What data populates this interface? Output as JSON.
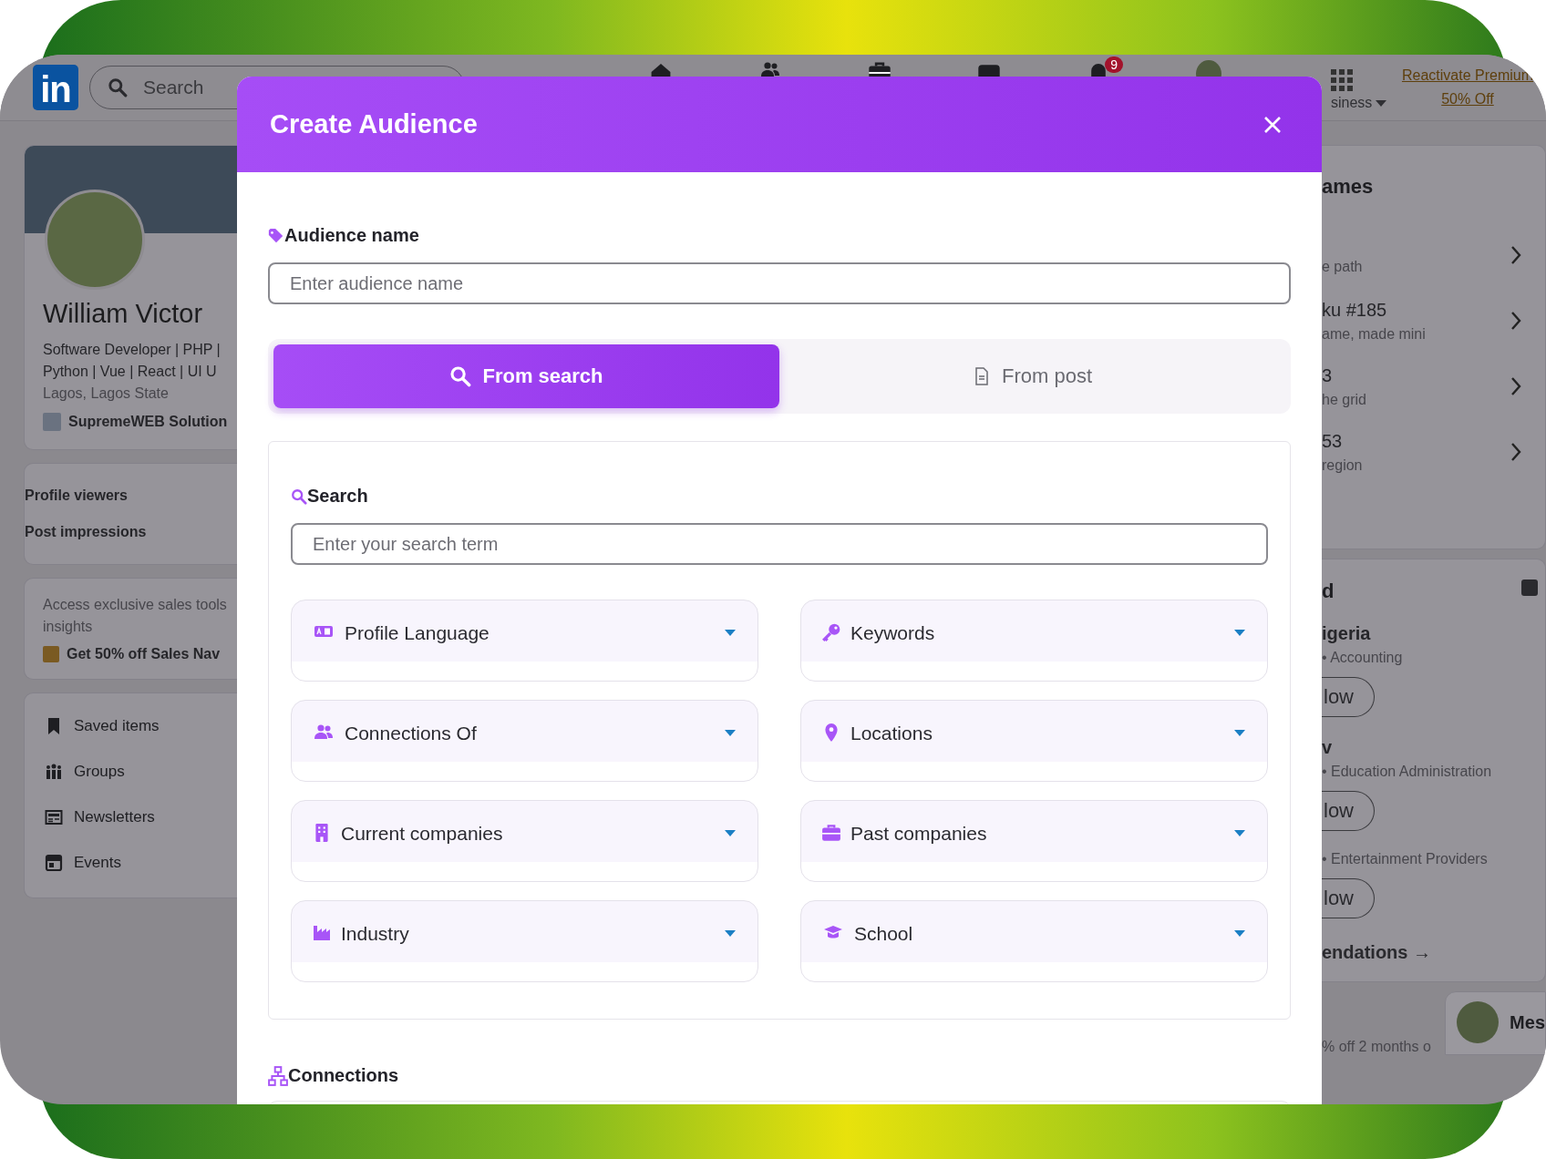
{
  "backdrop": {
    "nav": {
      "logo": "in",
      "search": {
        "placeholder": "Search"
      },
      "icons": [
        {
          "kind": "home"
        },
        {
          "kind": "people"
        },
        {
          "kind": "briefcase"
        },
        {
          "kind": "message"
        },
        {
          "kind": "bell",
          "badge": "9"
        },
        {
          "kind": "avatar"
        }
      ],
      "work_label": "siness",
      "premium": {
        "link": "Reactivate Premium",
        "offer": "50% Off"
      }
    },
    "profile": {
      "name": "William Victor",
      "headline_lines": [
        "Software Developer | PHP |",
        "Python | Vue | React | UI U"
      ],
      "location": "Lagos, Lagos State",
      "company": "SupremeWEB Solution"
    },
    "stats": [
      "Profile viewers",
      "Post impressions"
    ],
    "promo": {
      "text_lines": [
        "Access exclusive sales tools",
        "insights"
      ],
      "link": "Get 50% off Sales Nav"
    },
    "shortcuts": [
      {
        "kind": "bookmark",
        "label": "Saved items"
      },
      {
        "kind": "groups",
        "label": "Groups"
      },
      {
        "kind": "newsletter",
        "label": "Newsletters"
      },
      {
        "kind": "calendar",
        "label": "Events"
      }
    ],
    "games": {
      "title": "ames",
      "items": [
        {
          "subtitle": "e path"
        },
        {
          "title": "ku #185",
          "subtitle": "ame, made mini"
        },
        {
          "title": "3",
          "subtitle": "he grid"
        },
        {
          "title": "53",
          "subtitle": "region"
        }
      ]
    },
    "suggestions": {
      "title": "d",
      "people": [
        {
          "name": "igeria",
          "detail": "• Accounting",
          "button": "low"
        },
        {
          "name": "v",
          "detail": "• Education Administration",
          "button": "low"
        },
        {
          "detail": "• Entertainment Providers",
          "button": "low"
        }
      ],
      "footer_link": "endations →"
    },
    "ad_text": "% off 2 months o",
    "messaging": {
      "label": "Mes"
    }
  },
  "modal": {
    "title": "Create Audience",
    "audience_name": {
      "label": "Audience name",
      "placeholder": "Enter audience name"
    },
    "tabs": [
      {
        "kind": "search",
        "label": "From search",
        "selected": true
      },
      {
        "kind": "post",
        "label": "From post",
        "selected": false
      }
    ],
    "search_panel": {
      "label": "Search",
      "placeholder": "Enter your search term",
      "filters": [
        {
          "kind": "language",
          "label": "Profile Language"
        },
        {
          "kind": "key",
          "label": "Keywords"
        },
        {
          "kind": "people",
          "label": "Connections Of"
        },
        {
          "kind": "pin",
          "label": "Locations"
        },
        {
          "kind": "building",
          "label": "Current companies"
        },
        {
          "kind": "briefcase",
          "label": "Past companies"
        },
        {
          "kind": "industry",
          "label": "Industry"
        },
        {
          "kind": "school",
          "label": "School"
        }
      ]
    },
    "connections": {
      "label": "Connections"
    }
  }
}
